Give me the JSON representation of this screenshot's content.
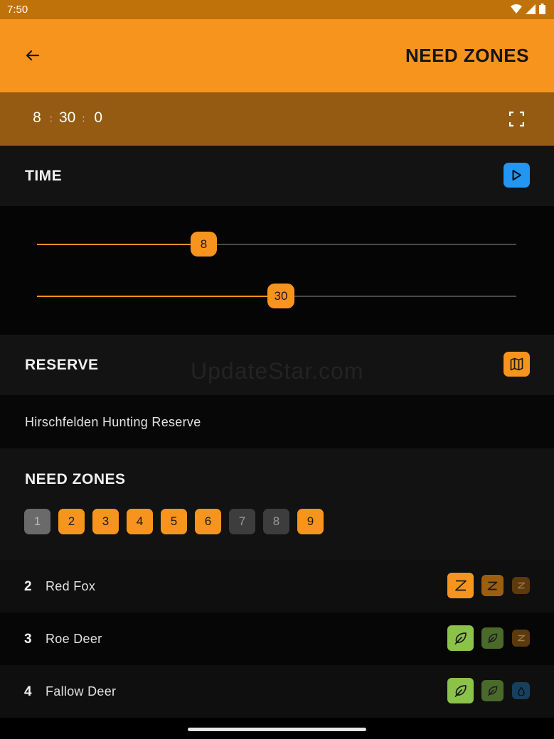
{
  "status": {
    "time": "7:50"
  },
  "app": {
    "title": "NEED ZONES"
  },
  "clock": {
    "hours": "8",
    "minutes": "30",
    "seconds": "0",
    "separator": ":"
  },
  "time_section": {
    "label": "TIME"
  },
  "sliders": {
    "hour": {
      "value": "8",
      "fraction": 0.35
    },
    "minute": {
      "value": "30",
      "fraction": 0.51
    }
  },
  "reserve_section": {
    "label": "RESERVE",
    "value": "Hirschfelden Hunting Reserve"
  },
  "watermark": "UpdateStar.com",
  "zones_section": {
    "label": "NEED ZONES",
    "chips": [
      {
        "label": "1",
        "state": "sel"
      },
      {
        "label": "2",
        "state": "on"
      },
      {
        "label": "3",
        "state": "on"
      },
      {
        "label": "4",
        "state": "on"
      },
      {
        "label": "5",
        "state": "on"
      },
      {
        "label": "6",
        "state": "on"
      },
      {
        "label": "7",
        "state": "off"
      },
      {
        "label": "8",
        "state": "off"
      },
      {
        "label": "9",
        "state": "on"
      }
    ]
  },
  "animals": [
    {
      "num": "2",
      "name": "Red Fox",
      "needs": [
        "sleep-icon",
        "sleep-icon",
        "sleep-icon"
      ]
    },
    {
      "num": "3",
      "name": "Roe Deer",
      "needs": [
        "feed-icon",
        "feed-icon",
        "sleep-icon"
      ]
    },
    {
      "num": "4",
      "name": "Fallow Deer",
      "needs": [
        "feed-icon",
        "feed-icon",
        "drink-icon"
      ]
    }
  ],
  "colors": {
    "accent": "#f7941d",
    "play": "#2196f3",
    "feed": "#8bc34a",
    "drink": "#2196f3"
  }
}
